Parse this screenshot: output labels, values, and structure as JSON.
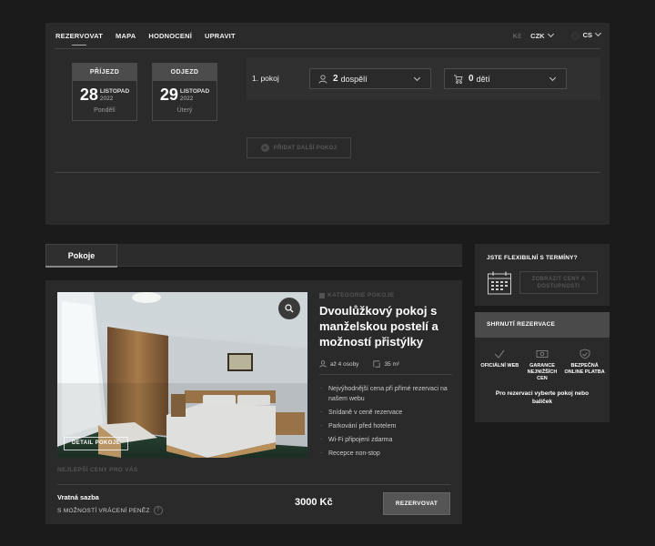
{
  "nav": {
    "items": [
      "REZERVOVAT",
      "MAPA",
      "HODNOCENÍ",
      "UPRAVIT"
    ],
    "currency_symbol": "Kč",
    "currency": "CZK",
    "language": "CS"
  },
  "dates": {
    "arrival": {
      "label": "PŘÍJEZD",
      "day": "28",
      "month": "LISTOPAD",
      "year": "2022",
      "weekday": "Pondělí"
    },
    "departure": {
      "label": "ODJEZD",
      "day": "29",
      "month": "LISTOPAD",
      "year": "2022",
      "weekday": "Úterý"
    }
  },
  "room": {
    "label": "1. pokoj",
    "adults_count": "2",
    "adults_label": "dospělí",
    "children_count": "0",
    "children_label": "dětí",
    "add_room": "PŘIDAT DALŠÍ POKOJ"
  },
  "tabs": {
    "rooms": "Pokoje"
  },
  "card": {
    "detail_button": "DETAIL POKOJE",
    "cheapest_label": "NEJLEPŠÍ CENY PRO VÁS",
    "category": "KATEGORIE POKOJE",
    "title": "Dvoulůžkový pokoj s manželskou postelí a možností přistýlky",
    "persons": "až 4 osoby",
    "area": "35 m²",
    "features": [
      "Nejvýhodnější cena při přímé rezervaci na našem webu",
      "Snídaně v ceně rezervace",
      "Parkování před hotelem",
      "Wi-Fi připojení zdarma",
      "Recepce non-stop"
    ],
    "rate_name": "Vratná sazba",
    "rate_sub": "S MOŽNOSTÍ VRÁCENÍ PENĚZ",
    "help_glyph": "?",
    "price": "3000 Kč",
    "book_button": "REZERVOVAT"
  },
  "flexible": {
    "title": "JSTE FLEXIBILNÍ S TERMÍNY?",
    "button": "ZOBRAZIT CENY A DOSTUPNOSTI"
  },
  "summary": {
    "title": "SHRNUTÍ REZERVACE",
    "guarantees": [
      "OFICIÁLNÍ WEB",
      "GARANCE NEJNIŽŠÍCH CEN",
      "BEZPEČNÁ ONLINE PLATBA"
    ],
    "note": "Pro rezervaci vyberte pokoj nebo balíček"
  },
  "colors": {
    "background": "#1b1b1b",
    "panel": "#2a2a2a",
    "header": "#4a4a4a",
    "button": "#555555"
  }
}
